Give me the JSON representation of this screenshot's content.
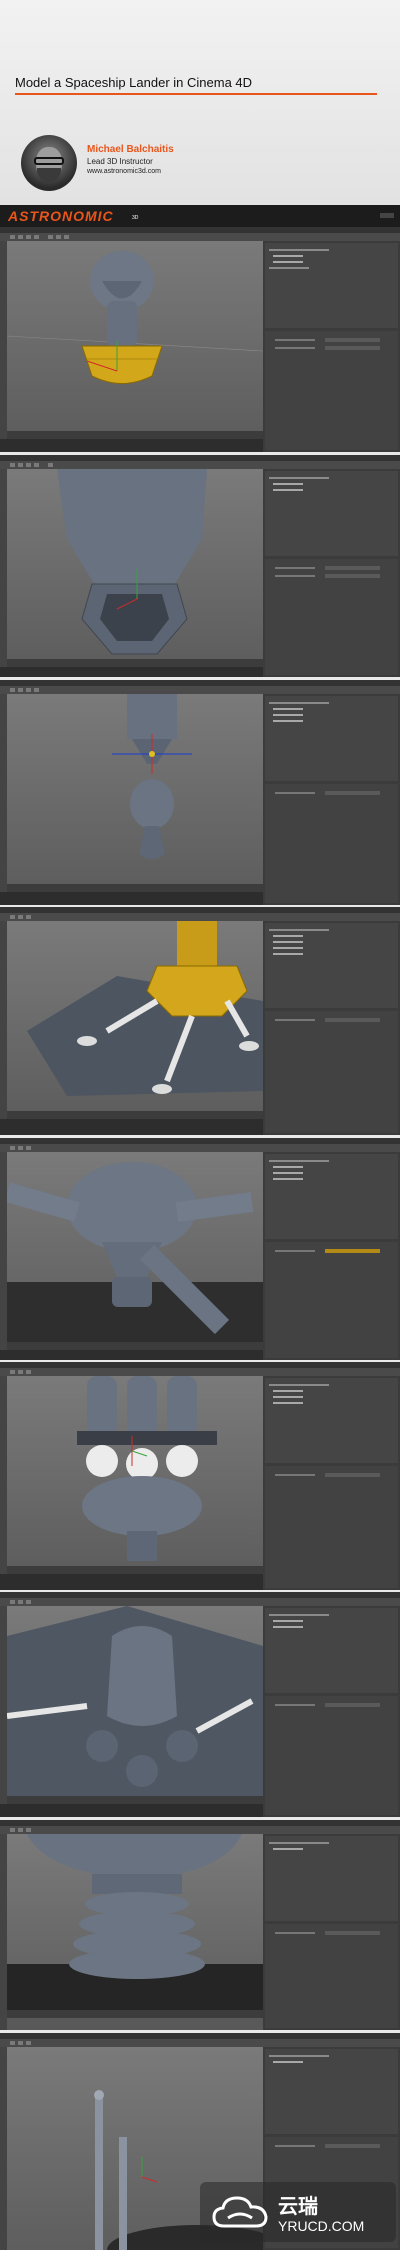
{
  "header": {
    "title": "Model a Spaceship Lander in Cinema 4D",
    "instructor_name": "Michael Balchaitis",
    "instructor_role": "Lead 3D Instructor",
    "instructor_site": "www.astronomic3d.com"
  },
  "brand": {
    "logo": "ASTRONOMIC",
    "sub": "3D",
    "accent_color": "#e8561b"
  },
  "screenshots_count": 9,
  "watermark": {
    "chinese": "云瑞",
    "site": "YRUCD.COM"
  },
  "icons": [
    "cloud-icon"
  ]
}
